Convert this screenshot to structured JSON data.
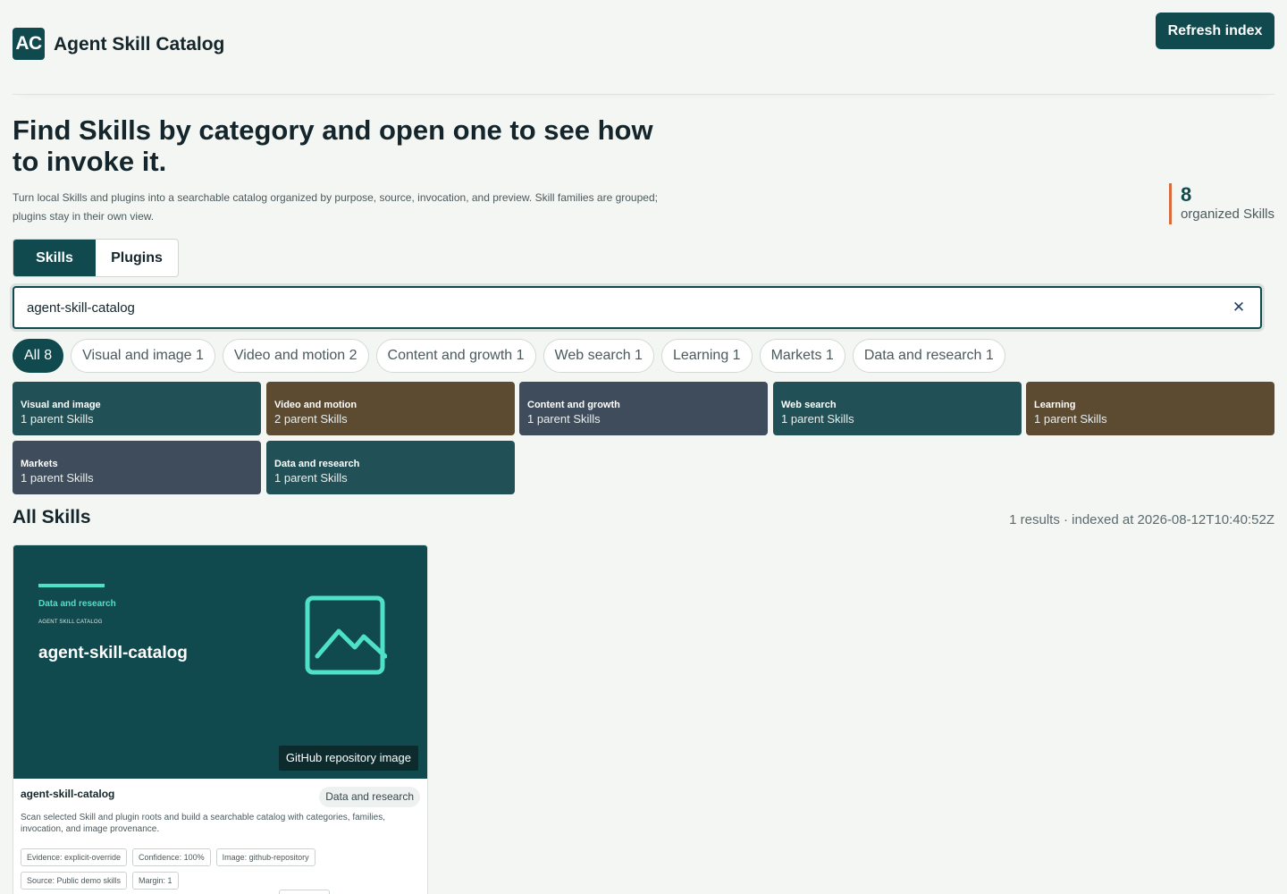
{
  "app": {
    "logo": "AC",
    "title": "Agent Skill Catalog",
    "refresh_label": "Refresh index"
  },
  "hero": {
    "title": "Find Skills by category and open one to see how to invoke it.",
    "description": "Turn local Skills and plugins into a searchable catalog organized by purpose, source, invocation, and preview. Skill families are grouped; plugins stay in their own view."
  },
  "stat": {
    "value": "8",
    "label": "organized Skills"
  },
  "tabs": [
    {
      "label": "Skills",
      "active": true
    },
    {
      "label": "Plugins",
      "active": false
    }
  ],
  "search": {
    "value": "agent-skill-catalog",
    "clear_icon": "close-icon"
  },
  "chips": [
    {
      "label": "All 8",
      "active": true
    },
    {
      "label": "Visual and image 1",
      "active": false
    },
    {
      "label": "Video and motion 2",
      "active": false
    },
    {
      "label": "Content and growth 1",
      "active": false
    },
    {
      "label": "Web search 1",
      "active": false
    },
    {
      "label": "Learning 1",
      "active": false
    },
    {
      "label": "Markets 1",
      "active": false
    },
    {
      "label": "Data and research 1",
      "active": false
    }
  ],
  "categories": [
    {
      "name": "Visual and image",
      "count": "1 parent Skills",
      "color": "#215156"
    },
    {
      "name": "Video and motion",
      "count": "2 parent Skills",
      "color": "#5c4a31"
    },
    {
      "name": "Content and growth",
      "count": "1 parent Skills",
      "color": "#3f4c5c"
    },
    {
      "name": "Web search",
      "count": "1 parent Skills",
      "color": "#215156"
    },
    {
      "name": "Learning",
      "count": "1 parent Skills",
      "color": "#5c4a31"
    },
    {
      "name": "Markets",
      "count": "1 parent Skills",
      "color": "#3f4c5c"
    },
    {
      "name": "Data and research",
      "count": "1 parent Skills",
      "color": "#215156"
    }
  ],
  "results": {
    "title": "All Skills",
    "meta": "1 results · indexed at 2026-08-12T10:40:52Z"
  },
  "card": {
    "preview": {
      "category": "Data and research",
      "eyebrow": "AGENT SKILL CATALOG",
      "name": "agent-skill-catalog",
      "icon": "image-icon",
      "source_label": "GitHub repository image"
    },
    "title": "agent-skill-catalog",
    "badge": "Data and research",
    "description": "Scan selected Skill and plugin roots and build a searchable catalog with categories, families, invocation, and image provenance.",
    "tags": [
      "Evidence: explicit-override",
      "Confidence: 100%",
      "Image: github-repository",
      "Source: Public demo skills",
      "Margin: 1"
    ]
  },
  "colors": {
    "primary": "#114a4e",
    "accent": "#4fe0c8",
    "stat_border": "#d86a3e",
    "background": "#f4f6f3"
  }
}
